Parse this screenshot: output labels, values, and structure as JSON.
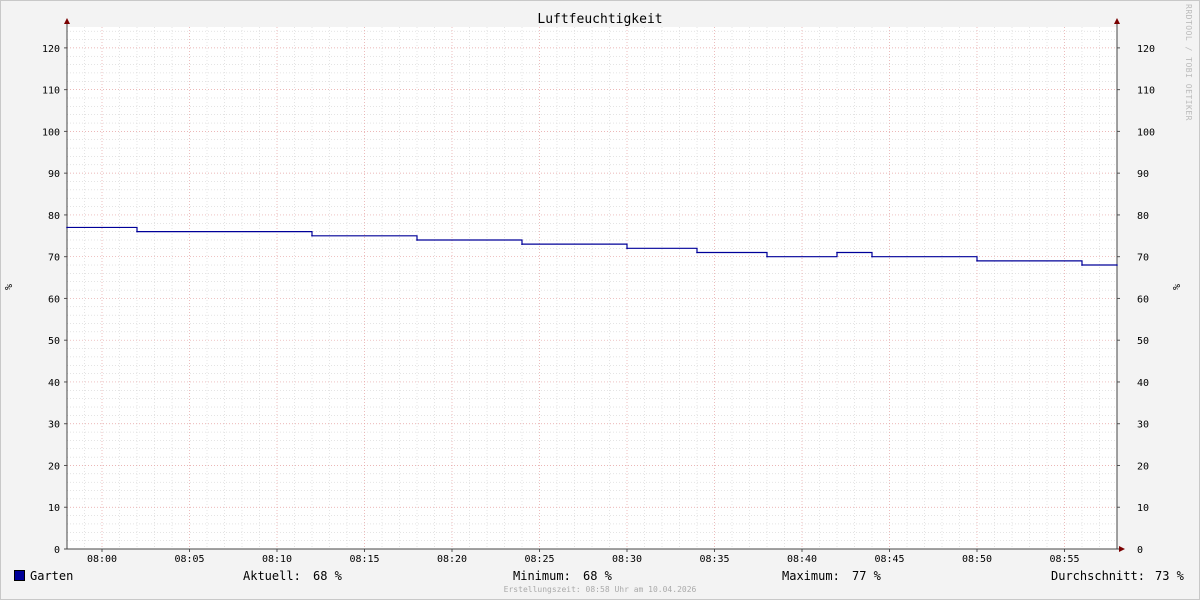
{
  "chart_data": {
    "type": "line",
    "title": "Luftfeuchtigkeit",
    "ylabel": "%",
    "ylim": [
      0,
      125
    ],
    "yticks": [
      0,
      10,
      20,
      30,
      40,
      50,
      60,
      70,
      80,
      90,
      100,
      110,
      120
    ],
    "xlim": [
      "07:58",
      "08:58"
    ],
    "xticks": [
      "08:00",
      "08:05",
      "08:10",
      "08:15",
      "08:20",
      "08:25",
      "08:30",
      "08:35",
      "08:40",
      "08:45",
      "08:50",
      "08:55"
    ],
    "series": [
      {
        "name": "Garten",
        "color": "#000099",
        "step": true,
        "x": [
          "07:58",
          "08:02",
          "08:12",
          "08:18",
          "08:24",
          "08:30",
          "08:34",
          "08:38",
          "08:42",
          "08:44",
          "08:50",
          "08:56",
          "08:58"
        ],
        "values": [
          77,
          76,
          75,
          74,
          73,
          72,
          71,
          70,
          71,
          70,
          69,
          68,
          68
        ]
      }
    ],
    "grid": true
  },
  "legend": {
    "series_label": "Garten",
    "current_label": "Aktuell:",
    "current_value": "68 %",
    "min_label": "Minimum:",
    "min_value": "68 %",
    "max_label": "Maximum:",
    "max_value": "77 %",
    "avg_label": "Durchschnitt:",
    "avg_value": "73 %"
  },
  "footer_note": "Erstellungszeit: 08:58 Uhr am 10.04.2026",
  "watermark": "RRDTOOL / TOBI OETIKER",
  "colors": {
    "background": "#f3f3f3",
    "canvas": "#ffffff",
    "major_grid": "#e5a0a0",
    "minor_grid": "#c9c9c9",
    "line": "#000099",
    "arrow": "#7a0000"
  }
}
